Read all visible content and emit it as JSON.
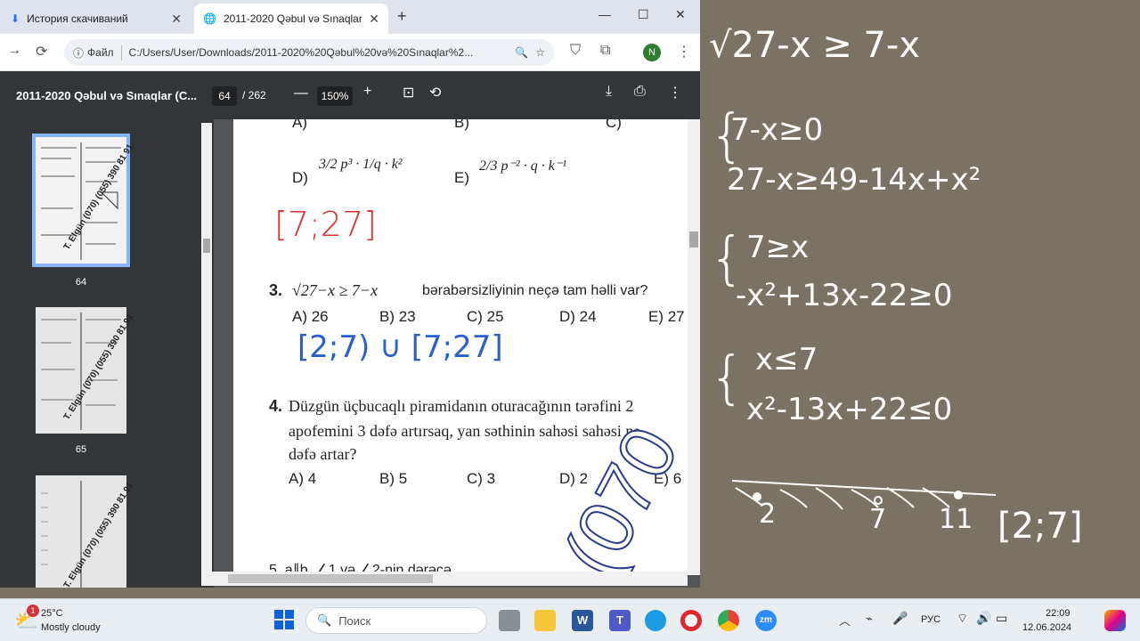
{
  "browser": {
    "tabs": [
      {
        "label": "История скачиваний"
      },
      {
        "label": "2011-2020 Qəbul və Sınaqlar (C"
      }
    ],
    "omnibox": {
      "chip": "Файл",
      "url": "C:/Users/User/Downloads/2011-2020%20Qəbul%20və%20Sınaqlar%2..."
    },
    "profile_initial": "N"
  },
  "pdf": {
    "title": "2011-2020 Qəbul və Sınaqlar (C...",
    "current_page": "64",
    "total_pages": "/ 262",
    "zoom": "150%",
    "thumbnails": [
      {
        "label": "64",
        "watermark": "T. Elgün (070) (055) 390 81 91"
      },
      {
        "label": "65",
        "watermark": "T. Elgün (070) (055) 390 81 91"
      },
      {
        "label": "",
        "watermark": "T. Elgün (070) (055) 390 81 91"
      }
    ]
  },
  "doc": {
    "row_top": [
      "A)",
      "B)",
      "C)"
    ],
    "q2_options": [
      {
        "label": "D)",
        "expr": "3/2 p³ · 1/q · k²"
      },
      {
        "label": "E)",
        "expr": "2/3 p⁻² · q · k⁻¹"
      }
    ],
    "hand_red": "[7;27]",
    "q3": {
      "num": "3.",
      "ineq": "√27−x ≥ 7−x",
      "text": "bərabərsizliyinin neçə tam həlli var?",
      "options": [
        "A) 26",
        "B) 23",
        "C) 25",
        "D) 24",
        "E) 27"
      ]
    },
    "hand_blue": "[2;7) ∪ [7;27]",
    "q4": {
      "num": "4.",
      "line1": "Düzgün üçbucaqlı piramidanın oturacağının tərəfini 2",
      "line2": "apofemini 3 dəfə artırsaq, yan səthinin sahəsi sahəsi nə",
      "line3": "dəfə artar?",
      "options": [
        "A) 4",
        "B) 5",
        "C) 3",
        "D) 2",
        "E) 6"
      ]
    },
    "watermark": "(070",
    "q5_partial": "5. a∥b,  ∠1 və  ∠2-nin dərəcə"
  },
  "handwriting": {
    "l1": "√27-x ≥ 7-x",
    "l2": "7-x≥0",
    "l3": "27-x≥49-14x+x²",
    "l4": "7≥x",
    "l5": "-x²+13x-22≥0",
    "l6": "x≤7",
    "l7": "x²-13x+22≤0",
    "n1": "2",
    "n2": "7",
    "n3": "11",
    "answer": "[2;7]"
  },
  "taskbar": {
    "weather_temp": "25°C",
    "weather_desc": "Mostly cloudy",
    "weather_badge": "1",
    "search_placeholder": "Поиск",
    "lang": "РУС",
    "time": "22:09",
    "date": "12.06.2024"
  }
}
